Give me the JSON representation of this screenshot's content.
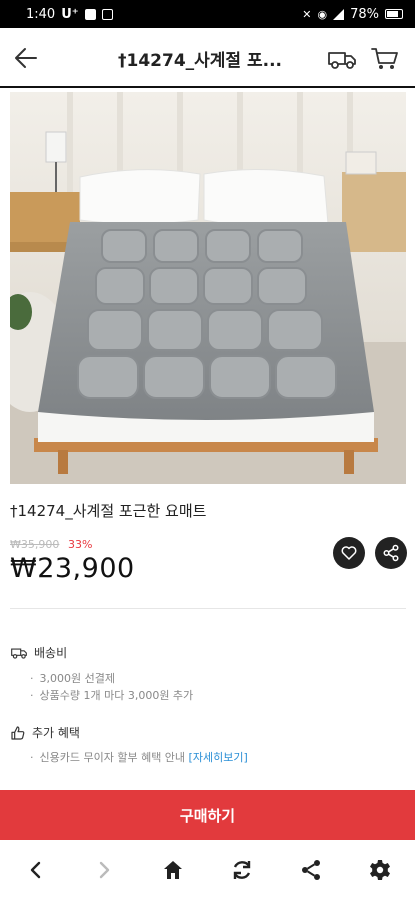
{
  "status": {
    "time": "1:40",
    "carrier": "U⁺",
    "battery": "78%"
  },
  "header": {
    "title": "†14274_사계절 포..."
  },
  "product": {
    "name": "†14274_사계절 포근한 요매트",
    "original_price": "₩35,900",
    "discount": "33%",
    "price": "₩23,900"
  },
  "shipping": {
    "title": "배송비",
    "lines": [
      "3,000원 선결제",
      "상품수량 1개 마다 3,000원 추가"
    ]
  },
  "benefits": {
    "title": "추가 혜택",
    "line": "신용카드 무이자 할부 혜택 안내",
    "link": "[자세히보기]"
  },
  "buy_button": {
    "label": "구매하기"
  },
  "colors": {
    "accent": "#e23a3d",
    "link": "#2a8fd6",
    "discount": "#e8373f"
  }
}
